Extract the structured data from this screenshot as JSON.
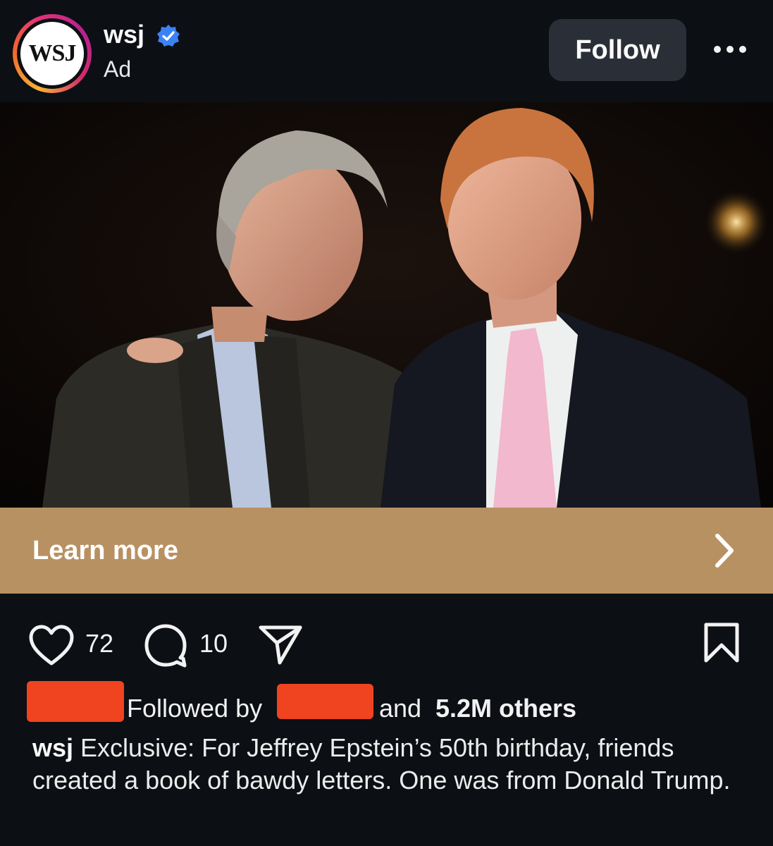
{
  "post": {
    "account": {
      "username": "wsj",
      "logo_text": "WSJ",
      "verified": true,
      "label": "Ad",
      "follow_label": "Follow"
    },
    "image": {
      "description_icon": "photo"
    },
    "cta": {
      "label": "Learn more",
      "background": "#b89163"
    },
    "actions": {
      "likes": "72",
      "comments": "10"
    },
    "social_proof": {
      "prefix": "Followed by",
      "suffix_start": "and",
      "others": "5.2M others"
    },
    "caption": {
      "username": "wsj",
      "text": "Exclusive: For Jeffrey Epstein’s 50th birthday, friends created a book of bawdy letters. One was from Donald Trump."
    }
  },
  "colors": {
    "background": "#0c0f14",
    "verified_blue": "#3b82f6",
    "redaction": "#f0431f"
  }
}
